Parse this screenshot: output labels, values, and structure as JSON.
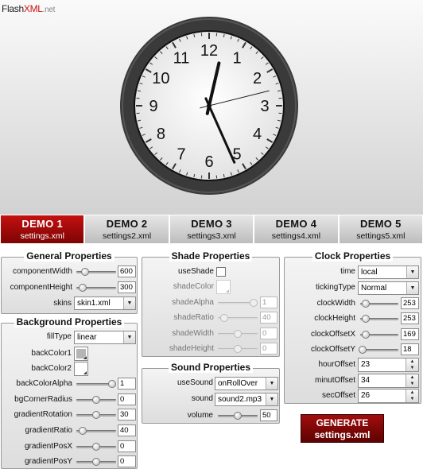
{
  "logo": {
    "part1": "Flash",
    "part2": "XML",
    "part3": ".net"
  },
  "clock": {
    "numerals": [
      "12",
      "1",
      "2",
      "3",
      "4",
      "5",
      "6",
      "7",
      "8",
      "9",
      "10",
      "11"
    ],
    "time": "12:26"
  },
  "tabs": [
    {
      "title": "DEMO 1",
      "file": "settings.xml",
      "active": true
    },
    {
      "title": "DEMO 2",
      "file": "settings2.xml",
      "active": false
    },
    {
      "title": "DEMO 3",
      "file": "settings3.xml",
      "active": false
    },
    {
      "title": "DEMO 4",
      "file": "settings4.xml",
      "active": false
    },
    {
      "title": "DEMO 5",
      "file": "settings5.xml",
      "active": false
    }
  ],
  "general": {
    "title": "General Properties",
    "componentWidth": {
      "label": "componentWidth",
      "value": "600"
    },
    "componentHeight": {
      "label": "componentHeight",
      "value": "300"
    },
    "skins": {
      "label": "skins",
      "value": "skin1.xml"
    }
  },
  "background": {
    "title": "Background Properties",
    "fillType": {
      "label": "fillType",
      "value": "linear"
    },
    "backColor1": {
      "label": "backColor1",
      "color": "#b5b5b5"
    },
    "backColor2": {
      "label": "backColor2",
      "color": "#ffffff"
    },
    "backColorAlpha": {
      "label": "backColorAlpha",
      "value": "1"
    },
    "bgCornerRadius": {
      "label": "bgCornerRadius",
      "value": "0"
    },
    "gradientRotation": {
      "label": "gradientRotation",
      "value": "30"
    },
    "gradientRatio": {
      "label": "gradientRatio",
      "value": "40"
    },
    "gradientPosX": {
      "label": "gradientPosX",
      "value": "0"
    },
    "gradientPosY": {
      "label": "gradientPosY",
      "value": "0"
    }
  },
  "shade": {
    "title": "Shade Properties",
    "useShade": {
      "label": "useShade"
    },
    "shadeColor": {
      "label": "shadeColor"
    },
    "shadeAlpha": {
      "label": "shadeAlpha",
      "value": "1"
    },
    "shadeRatio": {
      "label": "shadeRatio",
      "value": "40"
    },
    "shadeWidth": {
      "label": "shadeWidth",
      "value": "0"
    },
    "shadeHeight": {
      "label": "shadeHeight",
      "value": "0"
    }
  },
  "sound": {
    "title": "Sound Properties",
    "useSound": {
      "label": "useSound",
      "value": "onRollOver"
    },
    "sound": {
      "label": "sound",
      "value": "sound2.mp3"
    },
    "volume": {
      "label": "volume",
      "value": "50"
    }
  },
  "clockProps": {
    "title": "Clock Properties",
    "time": {
      "label": "time",
      "value": "local"
    },
    "tickingType": {
      "label": "tickingType",
      "value": "Normal"
    },
    "clockWidth": {
      "label": "clockWidth",
      "value": "253"
    },
    "clockHeight": {
      "label": "clockHeight",
      "value": "253"
    },
    "clockOffsetX": {
      "label": "clockOffsetX",
      "value": "169"
    },
    "clockOffsetY": {
      "label": "clockOffsetY",
      "value": "18"
    },
    "hourOffset": {
      "label": "hourOffset",
      "value": "23"
    },
    "minutOffset": {
      "label": "minutOffset",
      "value": "34"
    },
    "secOffset": {
      "label": "secOffset",
      "value": "26"
    }
  },
  "generate": {
    "line1": "GENERATE",
    "line2": "settings.xml"
  }
}
